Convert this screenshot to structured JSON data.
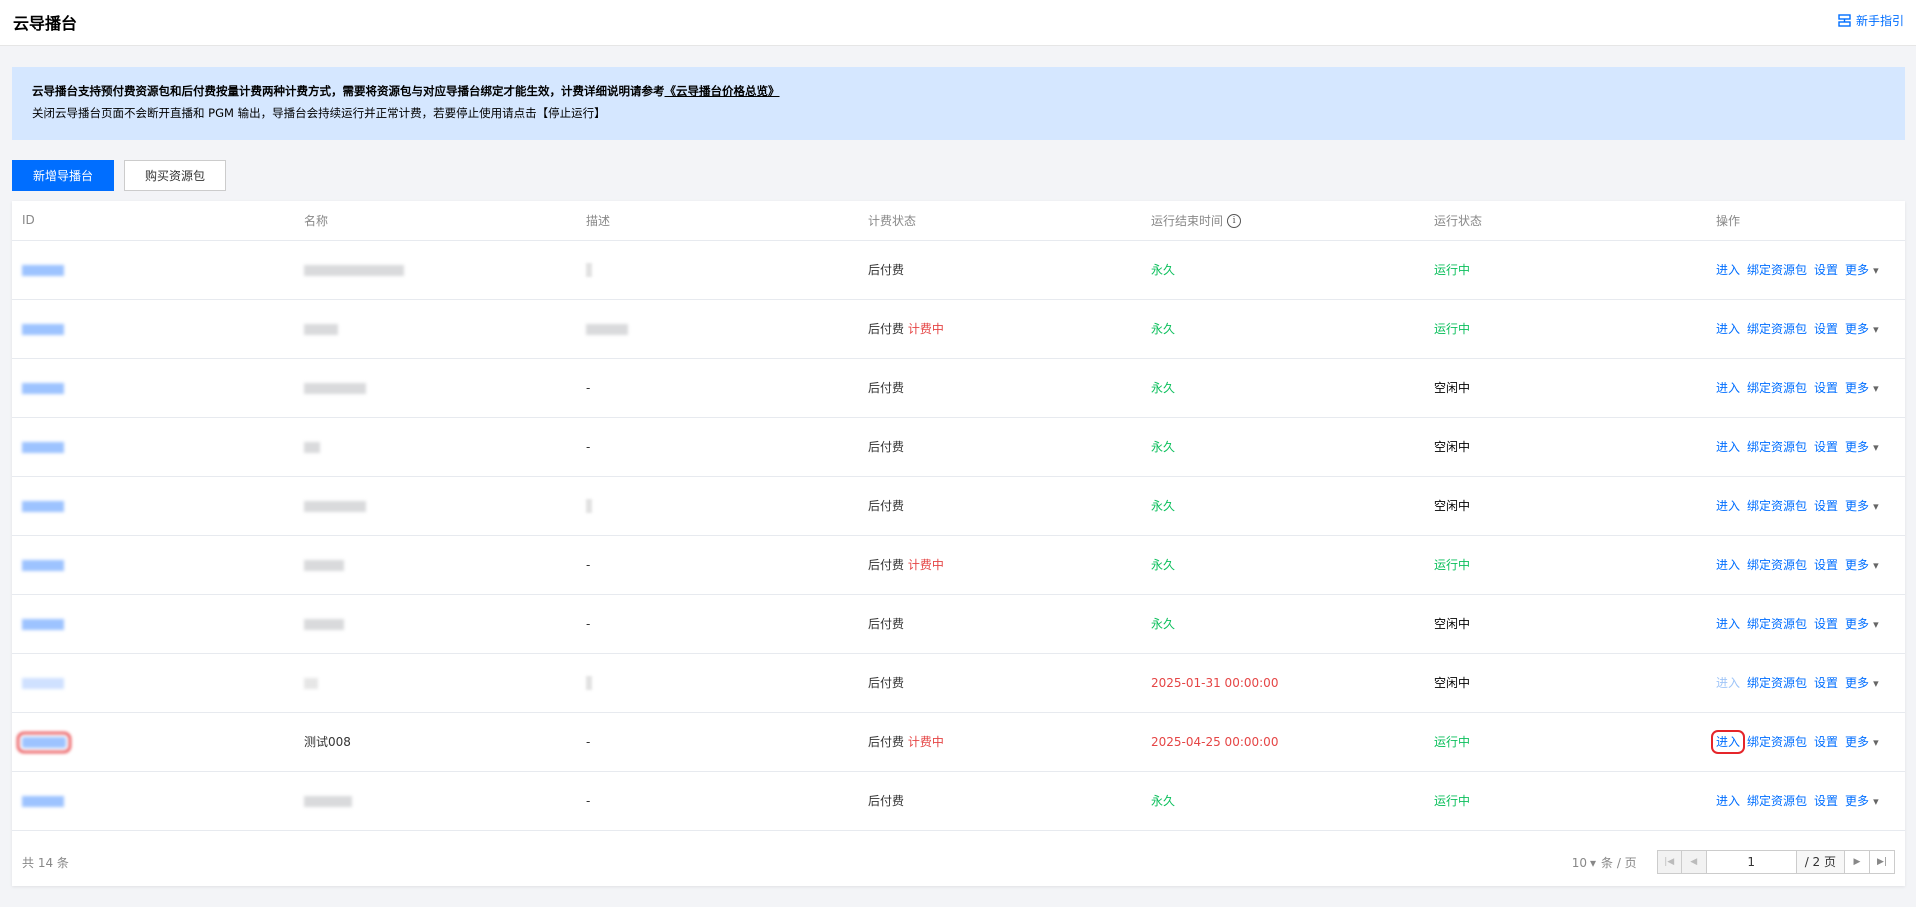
{
  "header": {
    "title": "云导播台",
    "guide_label": "新手指引",
    "guide_icon": "guide-icon"
  },
  "notice": {
    "line1_text": "云导播台支持预付费资源包和后付费按量计费两种计费方式，需要将资源包与对应导播台绑定才能生效，计费详细说明请参考",
    "line1_link": "《云导播台价格总览》",
    "line2_text": "关闭云导播台页面不会断开直播和 PGM 输出，导播台会持续运行并正常计费，若要停止使用请点击",
    "line2_link": "【停止运行】"
  },
  "toolbar": {
    "create_label": "新增导播台",
    "buy_label": "购买资源包"
  },
  "table": {
    "columns": [
      "ID",
      "名称",
      "描述",
      "计费状态",
      "运行结束时间",
      "运行状态",
      "操作"
    ],
    "ops": {
      "enter": "进入",
      "bind": "绑定资源包",
      "settings": "设置",
      "more": "更多"
    },
    "rows": [
      {
        "name": "",
        "desc": "",
        "billing": "后付费",
        "billing_extra": "",
        "end_time": "永久",
        "status": "运行中"
      },
      {
        "name": "",
        "desc": "",
        "billing": "后付费",
        "billing_extra": "计费中",
        "end_time": "永久",
        "status": "运行中"
      },
      {
        "name": "",
        "desc": "-",
        "billing": "后付费",
        "billing_extra": "",
        "end_time": "永久",
        "status": "空闲中"
      },
      {
        "name": "",
        "desc": "-",
        "billing": "后付费",
        "billing_extra": "",
        "end_time": "永久",
        "status": "空闲中"
      },
      {
        "name": "",
        "desc": "",
        "billing": "后付费",
        "billing_extra": "",
        "end_time": "永久",
        "status": "空闲中"
      },
      {
        "name": "",
        "desc": "-",
        "billing": "后付费",
        "billing_extra": "计费中",
        "end_time": "永久",
        "status": "运行中"
      },
      {
        "name": "",
        "desc": "-",
        "billing": "后付费",
        "billing_extra": "",
        "end_time": "永久",
        "status": "空闲中"
      },
      {
        "name": "",
        "desc": "",
        "billing": "后付费",
        "billing_extra": "",
        "end_time": "2025-01-31 00:00:00",
        "status": "空闲中"
      },
      {
        "name": "测试008",
        "desc": "-",
        "billing": "后付费",
        "billing_extra": "计费中",
        "end_time": "2025-04-25 00:00:00",
        "status": "运行中"
      },
      {
        "name": "",
        "desc": "-",
        "billing": "后付费",
        "billing_extra": "",
        "end_time": "永久",
        "status": "运行中"
      }
    ]
  },
  "footer": {
    "total": "共 14 条",
    "per_page": "10",
    "per_page_unit": "条 / 页",
    "current_page": "1",
    "total_pages": "/ 2 页"
  },
  "colors": {
    "accent": "#006eff",
    "running": "#0abf5b",
    "billing": "#e54545",
    "highlight": "#e5252a"
  }
}
